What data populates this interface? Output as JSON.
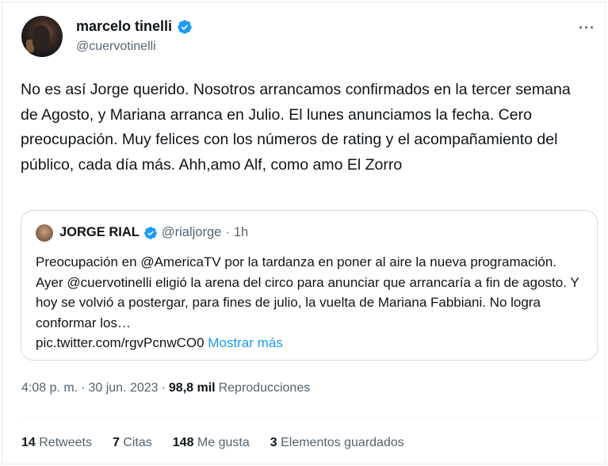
{
  "author": {
    "name": "marcelo tinelli",
    "handle": "@cuervotinelli"
  },
  "more_icon": "more-horizontal-icon",
  "tweet": {
    "text": "No es así Jorge querido. Nosotros arrancamos confirmados en la tercer semana de Agosto, y Mariana arranca en Julio. El lunes anunciamos la fecha. Cero preocupación. Muy felices con los números de rating y el acompañamiento del público, cada día más. Ahh,amo Alf, como amo El Zorro"
  },
  "quote": {
    "name": "JORGE RIAL",
    "handle": "@rialjorge",
    "separator": "·",
    "time": "1h",
    "text": "Preocupación en @AmericaTV por la tardanza en poner al aire la nueva programación. Ayer @cuervotinelli eligió la arena del circo para anunciar que arrancaría a fin de agosto. Y hoy se volvió a postergar, para fines de julio, la vuelta de Mariana Fabbiani. No logra conformar los…",
    "link": "pic.twitter.com/rgvPcnwCO0",
    "show_more": "Mostrar más"
  },
  "meta": {
    "time": "4:08 p. m.",
    "separator": "·",
    "date": "30 jun. 2023",
    "separator2": "·",
    "views": "98,8 mil",
    "views_label": "Reproducciones"
  },
  "stats": [
    {
      "count": "14",
      "label": "Retweets"
    },
    {
      "count": "7",
      "label": "Citas"
    },
    {
      "count": "148",
      "label": "Me gusta"
    },
    {
      "count": "3",
      "label": "Elementos guardados"
    }
  ],
  "colors": {
    "verified": "#1d9bf0",
    "link": "#1d9bf0",
    "secondary_text": "#536471",
    "border": "#cfd9de"
  }
}
